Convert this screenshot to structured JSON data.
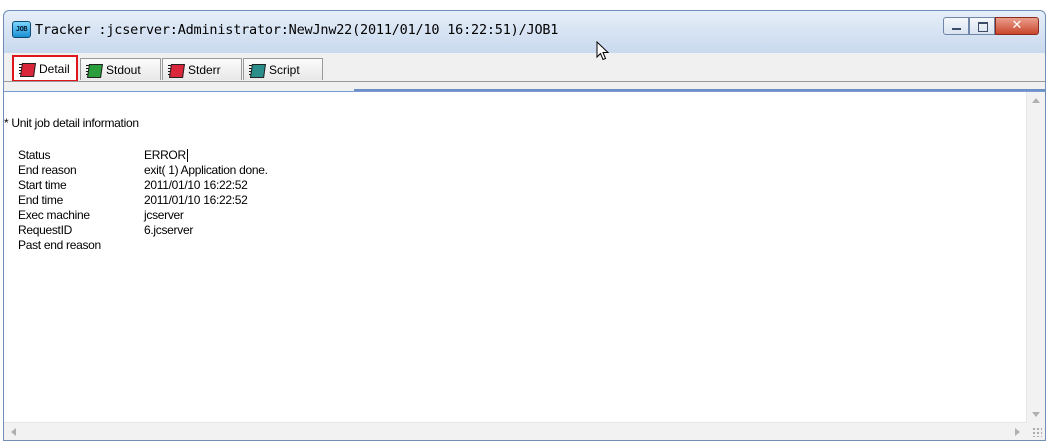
{
  "window": {
    "app_icon_label": "JOB",
    "title": "Tracker :jcserver:Administrator:NewJnw22(2011/01/10 16:22:51)/JOB1",
    "controls": {
      "minimize": "minimize",
      "maximize": "maximize",
      "close": "✕"
    }
  },
  "tabs": [
    {
      "label": "Detail",
      "icon": "notebook-red-icon",
      "active": true
    },
    {
      "label": "Stdout",
      "icon": "notebook-green-icon",
      "active": false
    },
    {
      "label": "Stderr",
      "icon": "notebook-red-icon",
      "active": false
    },
    {
      "label": "Script",
      "icon": "notebook-teal-icon",
      "active": false
    }
  ],
  "detail": {
    "heading": "* Unit job detail information",
    "fields": [
      {
        "key": "Status",
        "value": "ERROR"
      },
      {
        "key": "End reason",
        "value": "exit( 1) Application done."
      },
      {
        "key": "Start time",
        "value": "2011/01/10 16:22:52"
      },
      {
        "key": "End time",
        "value": "2011/01/10 16:22:52"
      },
      {
        "key": "Exec machine",
        "value": "jcserver"
      },
      {
        "key": "RequestID",
        "value": "6.jcserver"
      },
      {
        "key": "Past end reason",
        "value": ""
      }
    ]
  },
  "colors": {
    "active_tab_highlight": "#e0141b",
    "titlebar": "#d5e2f2",
    "close_button": "#c9452c"
  }
}
